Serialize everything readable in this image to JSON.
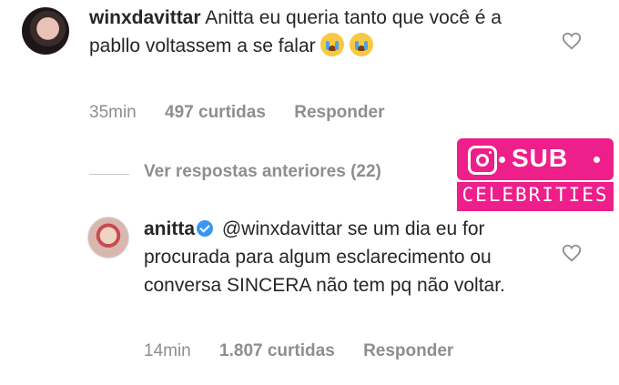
{
  "comment1": {
    "username": "winxdavittar",
    "text": "Anitta eu queria tanto que você é a pabllo voltassem a se falar",
    "time": "35min",
    "likes": "497 curtidas",
    "reply": "Responder"
  },
  "thread": {
    "view_previous": "Ver respostas anteriores (22)"
  },
  "comment2": {
    "username": "anitta",
    "mention": "@winxdavittar",
    "text": "se um dia eu for procurada para algum esclarecimento ou conversa SINCERA não tem pq não voltar.",
    "time": "14min",
    "likes": "1.807 curtidas",
    "reply": "Responder"
  },
  "watermark": {
    "line1": "SUB",
    "line2": "CELEBRITIES",
    "color": "#ee1e8a"
  },
  "icons": [
    "heart-icon",
    "verified-icon",
    "crying-emoji-icon",
    "instagram-icon"
  ]
}
